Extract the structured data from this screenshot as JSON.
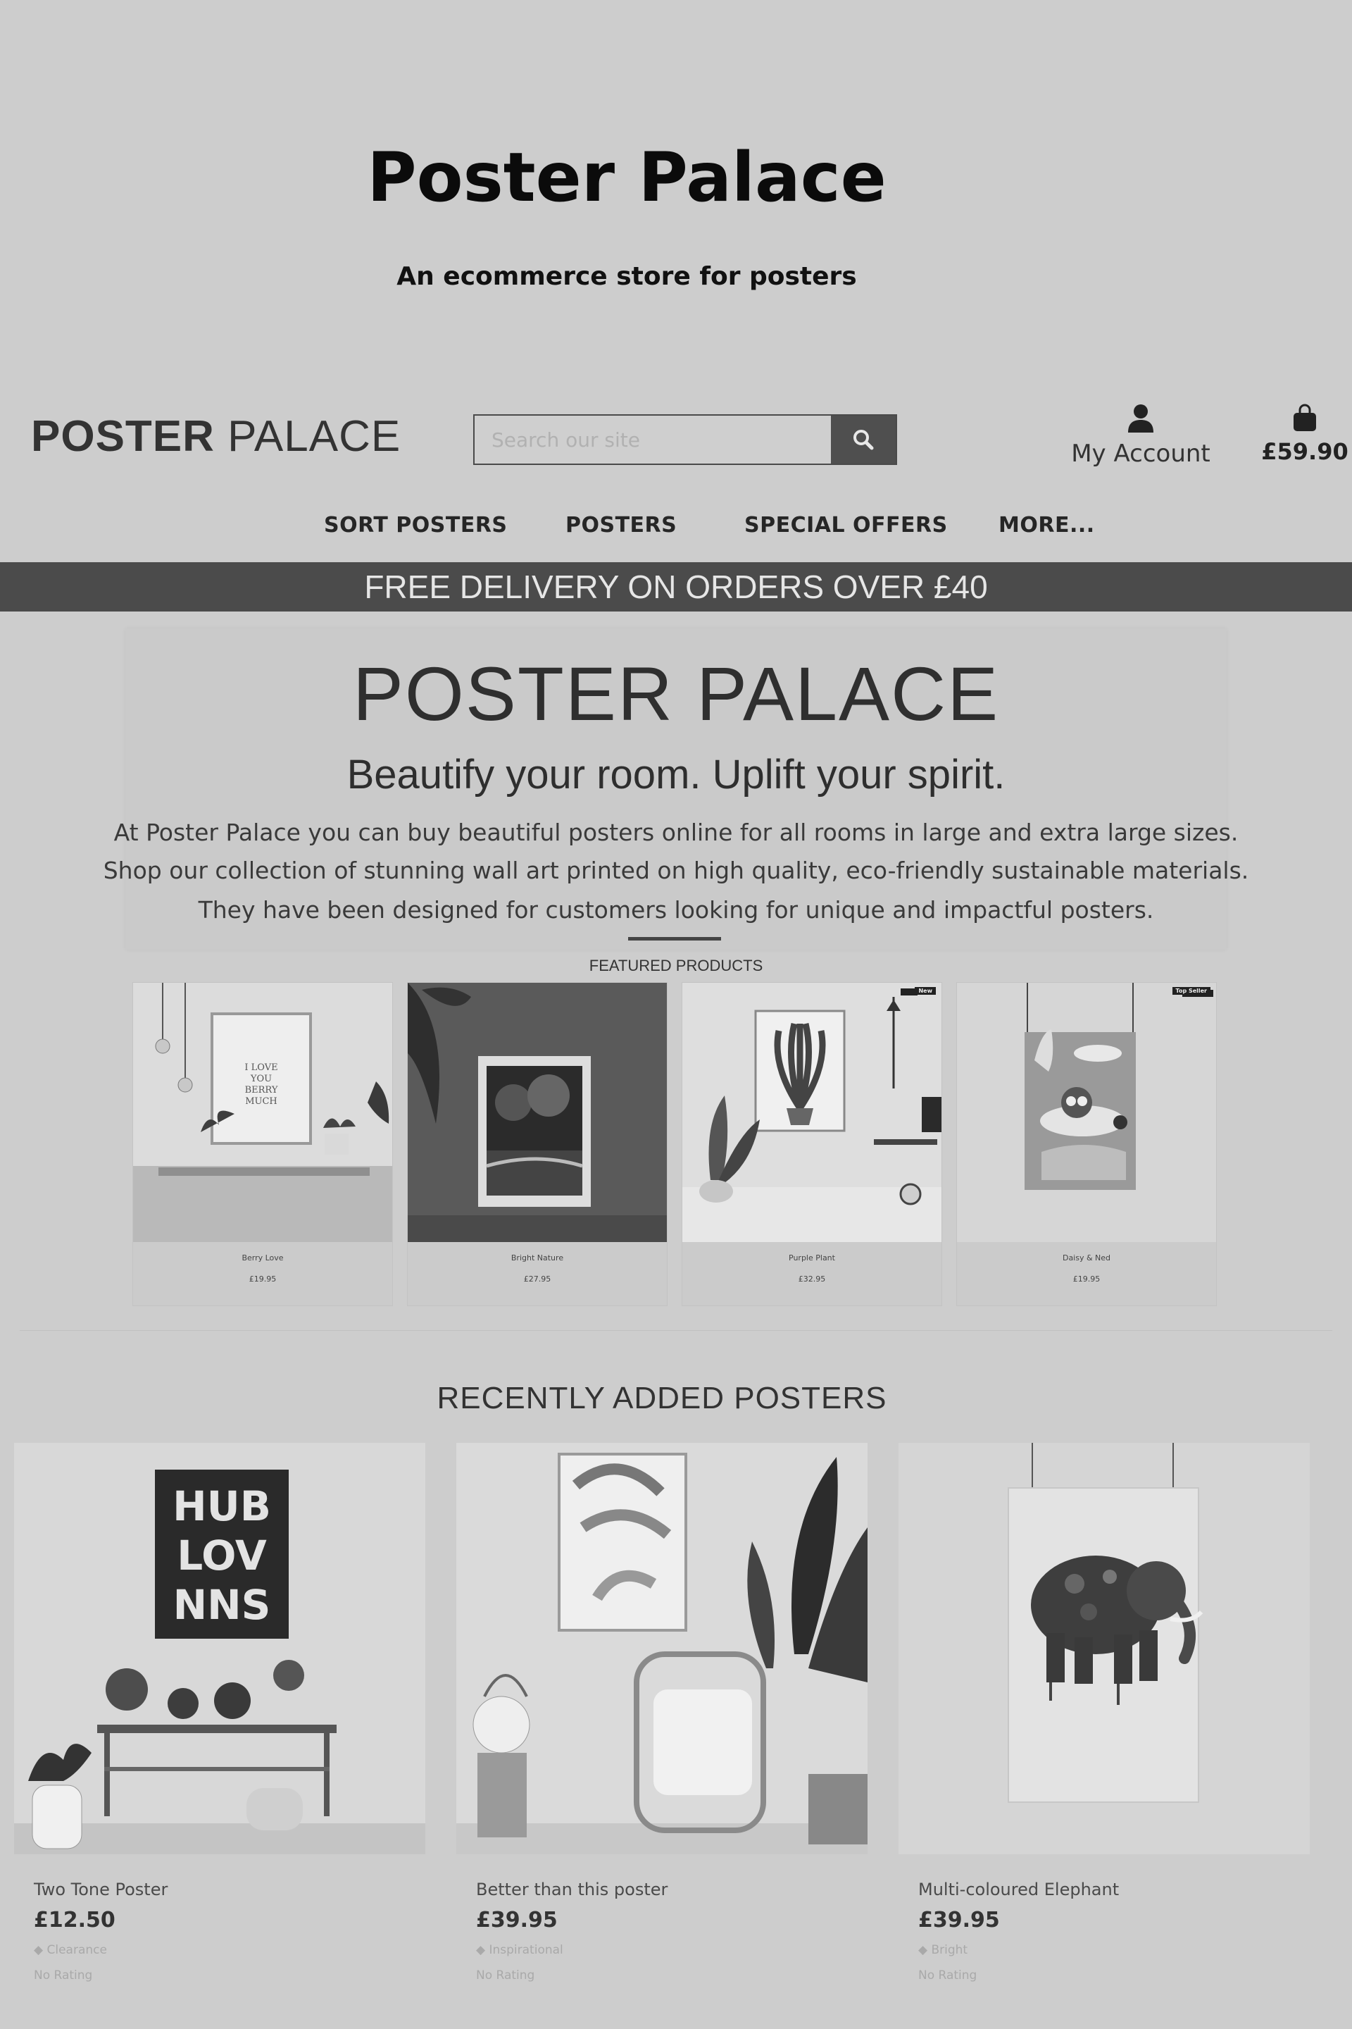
{
  "cover": {
    "title": "Poster Palace",
    "subtitle": "An ecommerce store for posters"
  },
  "header": {
    "logo_bold": "POSTER",
    "logo_light": "PALACE",
    "search_placeholder": "Search our site",
    "account_label": "My Account",
    "bag_total": "£59.90"
  },
  "nav": {
    "items": [
      "SORT POSTERS",
      "POSTERS",
      "SPECIAL OFFERS",
      "MORE..."
    ]
  },
  "banner": {
    "text": "FREE DELIVERY ON ORDERS OVER £40"
  },
  "hero": {
    "title": "POSTER PALACE",
    "subtitle": "Beautify your room. Uplift your spirit.",
    "lines": [
      "At Poster Palace you can buy beautiful posters online for all rooms in large and extra large sizes.",
      "Shop our collection of stunning wall art printed on high quality, eco-friendly sustainable materials.",
      "They have been designed for customers looking for unique and impactful posters."
    ]
  },
  "featured": {
    "label": "FEATURED PRODUCTS",
    "products": [
      {
        "name": "Berry Love",
        "price": "£19.95",
        "tag": "",
        "poster_text": [
          "I LOVE",
          "YOU",
          "BERRY",
          "MUCH"
        ]
      },
      {
        "name": "Bright Nature",
        "price": "£27.95",
        "tag": ""
      },
      {
        "name": "Purple Plant",
        "price": "£32.95",
        "tag": "New"
      },
      {
        "name": "Daisy & Ned",
        "price": "£19.95",
        "tag": "Top Seller"
      }
    ]
  },
  "recent": {
    "title": "RECENTLY ADDED POSTERS",
    "products": [
      {
        "name": "Two Tone Poster",
        "price": "£12.50",
        "tag": "Clearance",
        "rating": "No Rating"
      },
      {
        "name": "Better than this poster",
        "price": "£39.95",
        "tag": "Inspirational",
        "rating": "No Rating"
      },
      {
        "name": "Multi-coloured Elephant",
        "price": "£39.95",
        "tag": "Bright",
        "rating": "No Rating"
      }
    ]
  }
}
